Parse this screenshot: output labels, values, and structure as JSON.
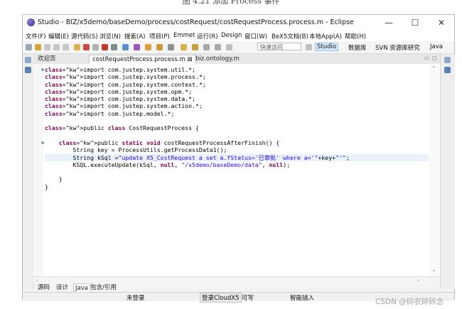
{
  "caption": "图 4.21   添加 Process 事件",
  "window": {
    "title": "Studio - BIZ/x5demo/baseDemo/process/costRequest/costRequestProcess.process.m - Eclipse",
    "controls": {
      "minimize": "—",
      "maximize": "☐",
      "close": "✕"
    }
  },
  "menu": [
    "文件(F)",
    "编辑(E)",
    "源代码(S)",
    "浏览(N)",
    "搜索(A)",
    "项目(P)",
    "Emmet",
    "运行(R)",
    "Design",
    "窗口(W)",
    "BeX5文档(B)",
    "本地App(A)",
    "帮助(H)"
  ],
  "toolbar": {
    "quick_access_placeholder": "快速访问",
    "perspectives": [
      "Studio",
      "数据库",
      "SVN 资源库研究",
      "Java"
    ]
  },
  "tabs": [
    {
      "label": "欢迎页"
    },
    {
      "label": "costRequestProcess.process.m",
      "close": "⊠"
    },
    {
      "label": "biz.ontology.m"
    }
  ],
  "code": [
    "import com.justep.system.util.*;",
    "import com.justep.system.process.*;",
    "import com.justep.system.context.*;",
    "import com.justep.system.opm.*;",
    "import com.justep.system.data.*;",
    "import com.justep.system.action.*;",
    "import com.justep.model.*;",
    "",
    "public class CostRequestProcess {",
    "",
    "    public static void costRequestProcessAfterFinish() {",
    "        String key = ProcessUtils.getProcessData1();",
    "        String kSql =\"update X5_CostRequest a set a.fStatus='已审批' where a='\"+key+\"'\";",
    "        KSQL.executeUpdate(kSql, null, \"/x5demo/baseDemo/data\", null);",
    "",
    "    }",
    "}"
  ],
  "highlighted_line": 12,
  "bottom_tabs": [
    "源码",
    "设计",
    "Java",
    "包含/引用"
  ],
  "active_bottom_tab": 2,
  "status": {
    "login": "未登录",
    "cloud": "登录CloudX5",
    "writable": "可写",
    "insert": "智能插入"
  },
  "watermark": "CSDN @码农碎碎念"
}
